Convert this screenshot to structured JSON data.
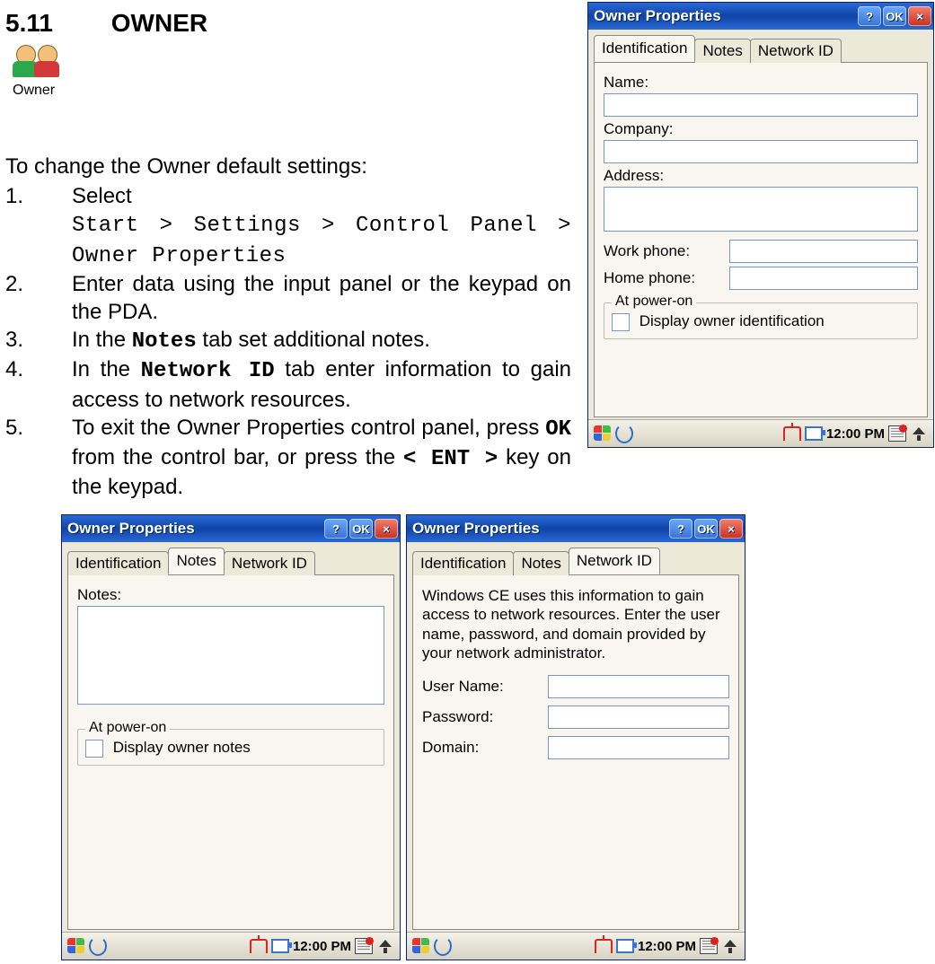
{
  "doc": {
    "section_num": "5.11",
    "section_title": "OWNER",
    "owner_icon_label": "Owner",
    "intro": "To change the Owner default settings:",
    "steps": {
      "s1": {
        "num": "1.",
        "lead": "Select",
        "path": "Start > Settings > Control Panel > Owner Properties"
      },
      "s2": {
        "num": "2.",
        "text": "Enter data using the input panel or the keypad on the PDA."
      },
      "s3": {
        "num": "3.",
        "pre": "In the ",
        "mono": "Notes",
        "post": " tab set additional notes."
      },
      "s4": {
        "num": "4.",
        "pre": "In the ",
        "mono": "Network ID",
        "post": " tab enter information to gain access to network resources."
      },
      "s5": {
        "num": "5.",
        "pre": "To exit the Owner Properties control panel, press ",
        "mono1": "OK",
        "mid": " from the control bar, or press the ",
        "mono2": "< ENT >",
        "post": " key on the keypad."
      }
    }
  },
  "win_ident": {
    "title": "Owner Properties",
    "btn_help": "?",
    "btn_ok": "OK",
    "btn_close": "×",
    "tabs": {
      "identification": "Identification",
      "notes": "Notes",
      "networkid": "Network ID"
    },
    "fields": {
      "name": "Name:",
      "company": "Company:",
      "address": "Address:",
      "workphone": "Work phone:",
      "homephone": "Home phone:"
    },
    "values": {
      "name": "",
      "company": "",
      "address": "",
      "workphone": "",
      "homephone": ""
    },
    "group": {
      "legend": "At power-on",
      "checkbox": "Display owner identification"
    }
  },
  "win_notes": {
    "title": "Owner Properties",
    "btn_help": "?",
    "btn_ok": "OK",
    "btn_close": "×",
    "tabs": {
      "identification": "Identification",
      "notes": "Notes",
      "networkid": "Network ID"
    },
    "label": "Notes:",
    "value": "",
    "group": {
      "legend": "At power-on",
      "checkbox": "Display owner notes"
    }
  },
  "win_netid": {
    "title": "Owner Properties",
    "btn_help": "?",
    "btn_ok": "OK",
    "btn_close": "×",
    "tabs": {
      "identification": "Identification",
      "notes": "Notes",
      "networkid": "Network ID"
    },
    "blurb": "Windows CE uses this information to gain access to network resources. Enter the user name, password, and domain provided by your network administrator.",
    "fields": {
      "username": "User Name:",
      "password": "Password:",
      "domain": "Domain:"
    },
    "values": {
      "username": "",
      "password": "",
      "domain": ""
    }
  },
  "taskbar": {
    "clock": "12:00 PM"
  }
}
